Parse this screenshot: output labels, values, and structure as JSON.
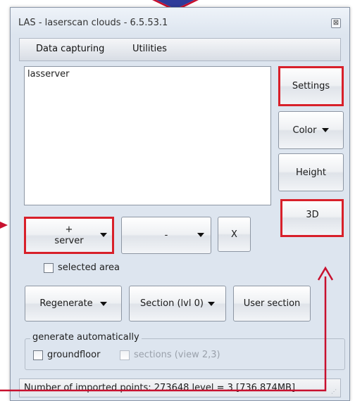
{
  "window": {
    "title": "LAS - laserscan clouds - 6.5.53.1",
    "close_glyph": "⊠"
  },
  "menubar": {
    "items": [
      "Data capturing",
      "Utilities"
    ]
  },
  "list": {
    "items": [
      "lasserver"
    ]
  },
  "side_buttons": {
    "settings": "Settings",
    "color": "Color",
    "height": "Height",
    "threed": "3D"
  },
  "row_buttons": {
    "add_top": "+",
    "add_bottom": "server",
    "remove": "-",
    "clear": "X"
  },
  "checkbox_selected_area": "selected area",
  "action_buttons": {
    "regenerate": "Regenerate",
    "section": "Section (lvl 0)",
    "user_section": "User section"
  },
  "generate": {
    "label": "generate automatically",
    "groundfloor": "groundfloor",
    "sections": "sections (view 2,3)"
  },
  "status": "Number of imported points: 273648 level = 3   [736.874MB]",
  "colors": {
    "highlight": "#d8202a",
    "annotation_arrow": "#c8102e",
    "window_bg": "#dde5ef",
    "top_arrow": "#2f3b9a"
  },
  "icons": {
    "close": "close-icon",
    "dropdown": "chevron-down-icon",
    "grip": "resize-grip-icon"
  }
}
